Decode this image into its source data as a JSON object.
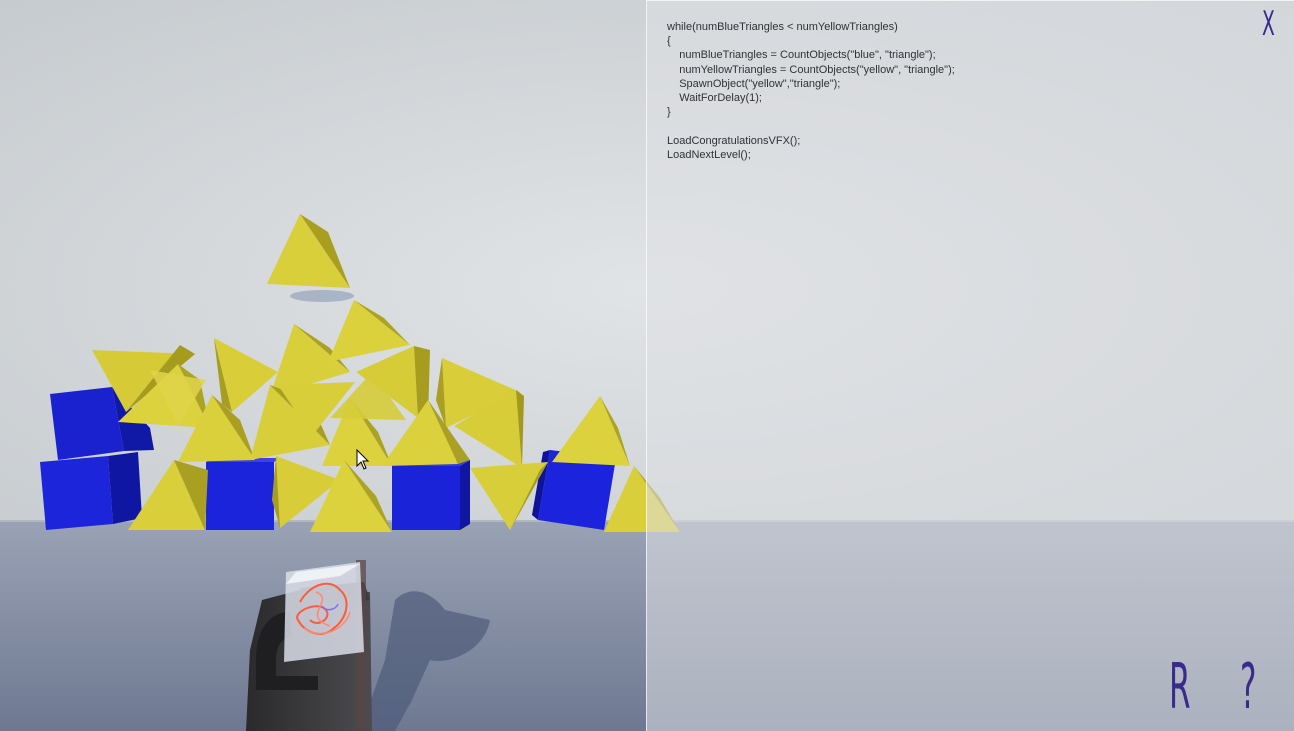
{
  "code_panel": {
    "lines": [
      "while(numBlueTriangles < numYellowTriangles)",
      "{",
      "    numBlueTriangles = CountObjects(\"blue\", \"triangle\");",
      "    numYellowTriangles = CountObjects(\"yellow\", \"triangle\");",
      "    SpawnObject(\"yellow\",\"triangle\");",
      "    WaitForDelay(1);",
      "}",
      "",
      "LoadCongratulationsVFX();",
      "LoadNextLevel();"
    ]
  },
  "controls": {
    "close_label": "X",
    "reset_label": "R",
    "help_label": "?"
  },
  "colors": {
    "accent": "#3a2a8c",
    "yellow_object": "#d9cf3a",
    "blue_object": "#1a23d8",
    "wall": "#d3d6d9",
    "floor": "#7f8aa3"
  },
  "scene_objects": {
    "blue_cubes": 6,
    "yellow_triangles": 24
  }
}
